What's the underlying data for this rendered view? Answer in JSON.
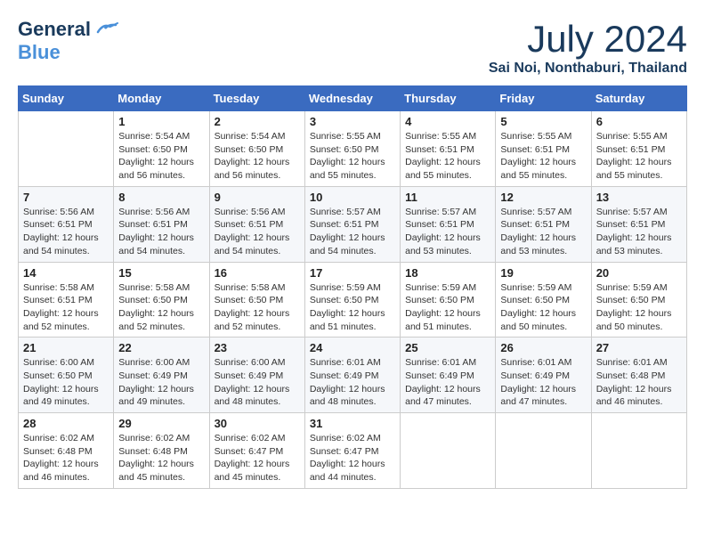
{
  "logo": {
    "line1": "General",
    "line2": "Blue"
  },
  "title": {
    "month_year": "July 2024",
    "location": "Sai Noi, Nonthaburi, Thailand"
  },
  "weekdays": [
    "Sunday",
    "Monday",
    "Tuesday",
    "Wednesday",
    "Thursday",
    "Friday",
    "Saturday"
  ],
  "weeks": [
    [
      {
        "day": "",
        "info": ""
      },
      {
        "day": "1",
        "info": "Sunrise: 5:54 AM\nSunset: 6:50 PM\nDaylight: 12 hours\nand 56 minutes."
      },
      {
        "day": "2",
        "info": "Sunrise: 5:54 AM\nSunset: 6:50 PM\nDaylight: 12 hours\nand 56 minutes."
      },
      {
        "day": "3",
        "info": "Sunrise: 5:55 AM\nSunset: 6:50 PM\nDaylight: 12 hours\nand 55 minutes."
      },
      {
        "day": "4",
        "info": "Sunrise: 5:55 AM\nSunset: 6:51 PM\nDaylight: 12 hours\nand 55 minutes."
      },
      {
        "day": "5",
        "info": "Sunrise: 5:55 AM\nSunset: 6:51 PM\nDaylight: 12 hours\nand 55 minutes."
      },
      {
        "day": "6",
        "info": "Sunrise: 5:55 AM\nSunset: 6:51 PM\nDaylight: 12 hours\nand 55 minutes."
      }
    ],
    [
      {
        "day": "7",
        "info": "Sunrise: 5:56 AM\nSunset: 6:51 PM\nDaylight: 12 hours\nand 54 minutes."
      },
      {
        "day": "8",
        "info": "Sunrise: 5:56 AM\nSunset: 6:51 PM\nDaylight: 12 hours\nand 54 minutes."
      },
      {
        "day": "9",
        "info": "Sunrise: 5:56 AM\nSunset: 6:51 PM\nDaylight: 12 hours\nand 54 minutes."
      },
      {
        "day": "10",
        "info": "Sunrise: 5:57 AM\nSunset: 6:51 PM\nDaylight: 12 hours\nand 54 minutes."
      },
      {
        "day": "11",
        "info": "Sunrise: 5:57 AM\nSunset: 6:51 PM\nDaylight: 12 hours\nand 53 minutes."
      },
      {
        "day": "12",
        "info": "Sunrise: 5:57 AM\nSunset: 6:51 PM\nDaylight: 12 hours\nand 53 minutes."
      },
      {
        "day": "13",
        "info": "Sunrise: 5:57 AM\nSunset: 6:51 PM\nDaylight: 12 hours\nand 53 minutes."
      }
    ],
    [
      {
        "day": "14",
        "info": "Sunrise: 5:58 AM\nSunset: 6:51 PM\nDaylight: 12 hours\nand 52 minutes."
      },
      {
        "day": "15",
        "info": "Sunrise: 5:58 AM\nSunset: 6:50 PM\nDaylight: 12 hours\nand 52 minutes."
      },
      {
        "day": "16",
        "info": "Sunrise: 5:58 AM\nSunset: 6:50 PM\nDaylight: 12 hours\nand 52 minutes."
      },
      {
        "day": "17",
        "info": "Sunrise: 5:59 AM\nSunset: 6:50 PM\nDaylight: 12 hours\nand 51 minutes."
      },
      {
        "day": "18",
        "info": "Sunrise: 5:59 AM\nSunset: 6:50 PM\nDaylight: 12 hours\nand 51 minutes."
      },
      {
        "day": "19",
        "info": "Sunrise: 5:59 AM\nSunset: 6:50 PM\nDaylight: 12 hours\nand 50 minutes."
      },
      {
        "day": "20",
        "info": "Sunrise: 5:59 AM\nSunset: 6:50 PM\nDaylight: 12 hours\nand 50 minutes."
      }
    ],
    [
      {
        "day": "21",
        "info": "Sunrise: 6:00 AM\nSunset: 6:50 PM\nDaylight: 12 hours\nand 49 minutes."
      },
      {
        "day": "22",
        "info": "Sunrise: 6:00 AM\nSunset: 6:49 PM\nDaylight: 12 hours\nand 49 minutes."
      },
      {
        "day": "23",
        "info": "Sunrise: 6:00 AM\nSunset: 6:49 PM\nDaylight: 12 hours\nand 48 minutes."
      },
      {
        "day": "24",
        "info": "Sunrise: 6:01 AM\nSunset: 6:49 PM\nDaylight: 12 hours\nand 48 minutes."
      },
      {
        "day": "25",
        "info": "Sunrise: 6:01 AM\nSunset: 6:49 PM\nDaylight: 12 hours\nand 47 minutes."
      },
      {
        "day": "26",
        "info": "Sunrise: 6:01 AM\nSunset: 6:49 PM\nDaylight: 12 hours\nand 47 minutes."
      },
      {
        "day": "27",
        "info": "Sunrise: 6:01 AM\nSunset: 6:48 PM\nDaylight: 12 hours\nand 46 minutes."
      }
    ],
    [
      {
        "day": "28",
        "info": "Sunrise: 6:02 AM\nSunset: 6:48 PM\nDaylight: 12 hours\nand 46 minutes."
      },
      {
        "day": "29",
        "info": "Sunrise: 6:02 AM\nSunset: 6:48 PM\nDaylight: 12 hours\nand 45 minutes."
      },
      {
        "day": "30",
        "info": "Sunrise: 6:02 AM\nSunset: 6:47 PM\nDaylight: 12 hours\nand 45 minutes."
      },
      {
        "day": "31",
        "info": "Sunrise: 6:02 AM\nSunset: 6:47 PM\nDaylight: 12 hours\nand 44 minutes."
      },
      {
        "day": "",
        "info": ""
      },
      {
        "day": "",
        "info": ""
      },
      {
        "day": "",
        "info": ""
      }
    ]
  ]
}
